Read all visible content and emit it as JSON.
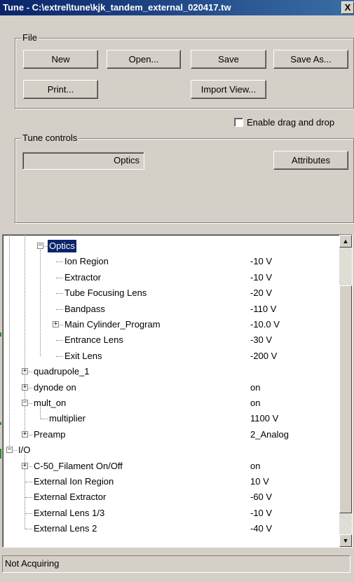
{
  "window": {
    "title": "Tune - C:\\extrel\\tune\\kjk_tandem_external_020417.tw",
    "close_label": "X"
  },
  "file_group": {
    "label": "File",
    "new_label": "New",
    "open_label": "Open...",
    "save_label": "Save",
    "save_as_label": "Save As...",
    "print_label": "Print...",
    "import_view_label": "Import View..."
  },
  "drag_drop": {
    "label": "Enable drag and drop",
    "checked": false
  },
  "tune_controls": {
    "label": "Tune controls",
    "field_value": "Optics",
    "attributes_label": "Attributes"
  },
  "tree": [
    {
      "label": "Optics",
      "value": "",
      "level": 2,
      "expander": "minus",
      "selected": true
    },
    {
      "label": "Ion Region",
      "value": "-10 V",
      "level": 3,
      "expander": null
    },
    {
      "label": "Extractor",
      "value": "-10 V",
      "level": 3,
      "expander": null
    },
    {
      "label": "Tube Focusing Lens",
      "value": "-20 V",
      "level": 3,
      "expander": null
    },
    {
      "label": "Bandpass",
      "value": "-110 V",
      "level": 3,
      "expander": null
    },
    {
      "label": "Main Cylinder_Program",
      "value": "-10.0 V",
      "level": 3,
      "expander": "plus"
    },
    {
      "label": "Entrance Lens",
      "value": "-30 V",
      "level": 3,
      "expander": null
    },
    {
      "label": "Exit Lens",
      "value": "-200 V",
      "level": 3,
      "expander": null
    },
    {
      "label": "quadrupole_1",
      "value": "",
      "level": 1,
      "expander": "plus"
    },
    {
      "label": "dynode on",
      "value": "on",
      "level": 1,
      "expander": "plus"
    },
    {
      "label": "mult_on",
      "value": "on",
      "level": 1,
      "expander": "minus"
    },
    {
      "label": "multiplier",
      "value": "1100 V",
      "level": 2,
      "expander": null
    },
    {
      "label": "Preamp",
      "value": "2_Analog",
      "level": 1,
      "expander": "plus"
    },
    {
      "label": "I/O",
      "value": "",
      "level": 0,
      "expander": "minus"
    },
    {
      "label": "C-50_Filament On/Off",
      "value": "on",
      "level": 1,
      "expander": "plus"
    },
    {
      "label": "External Ion Region",
      "value": "10 V",
      "level": 1,
      "expander": null
    },
    {
      "label": "External Extractor",
      "value": "-60 V",
      "level": 1,
      "expander": null
    },
    {
      "label": "External Lens 1/3",
      "value": "-10 V",
      "level": 1,
      "expander": null
    },
    {
      "label": "External Lens 2",
      "value": "-40 V",
      "level": 1,
      "expander": null
    }
  ],
  "status": {
    "text": "Not Acquiring"
  }
}
